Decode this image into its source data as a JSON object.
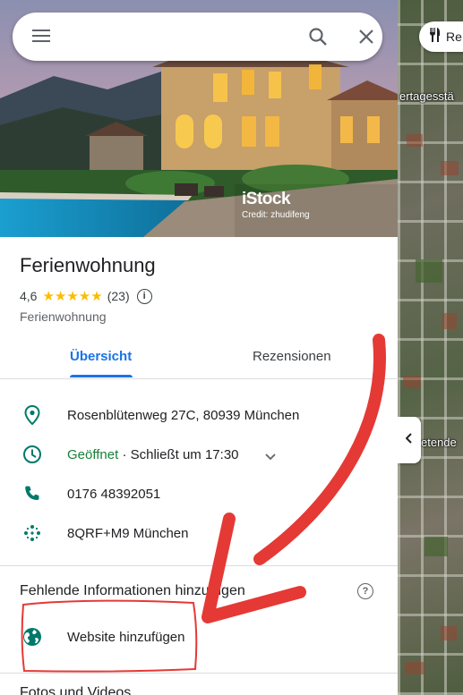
{
  "search": {
    "value": "",
    "placeholder": ""
  },
  "hero": {
    "watermark_brand": "iStock",
    "watermark_credit": "Credit: zhudifeng"
  },
  "place": {
    "title": "Ferienwohnung",
    "rating": "4,6",
    "stars": "★★★★★",
    "review_count": "(23)",
    "info_glyph": "i",
    "category": "Ferienwohnung"
  },
  "tabs": [
    {
      "label": "Übersicht",
      "active": true
    },
    {
      "label": "Rezensionen",
      "active": false
    }
  ],
  "details": {
    "address": "Rosenblütenweg 27C, 80939 München",
    "hours_status": "Geöffnet",
    "hours_rest": " · Schließt um 17:30",
    "phone": "0176 48392051",
    "plus_code": "8QRF+M9 München"
  },
  "missing_info": {
    "title": "Fehlende Informationen hinzufügen",
    "help_glyph": "?",
    "add_website": "Website hinzufügen"
  },
  "next_section": "Fotos und Videos",
  "map": {
    "chip_label": "Re",
    "street_1": "ertagesstä",
    "street_2": "etende"
  },
  "colors": {
    "accent": "#1a73e8",
    "icon_teal": "#00796b",
    "open_green": "#188038",
    "star": "#fbbc04",
    "annotation_red": "#e53935"
  },
  "icons": [
    "menu-icon",
    "search-icon",
    "close-icon",
    "location-pin-icon",
    "clock-icon",
    "chevron-down-icon",
    "phone-icon",
    "plus-code-icon",
    "globe-icon",
    "info-icon",
    "help-icon",
    "fork-knife-icon",
    "chevron-left-icon"
  ]
}
